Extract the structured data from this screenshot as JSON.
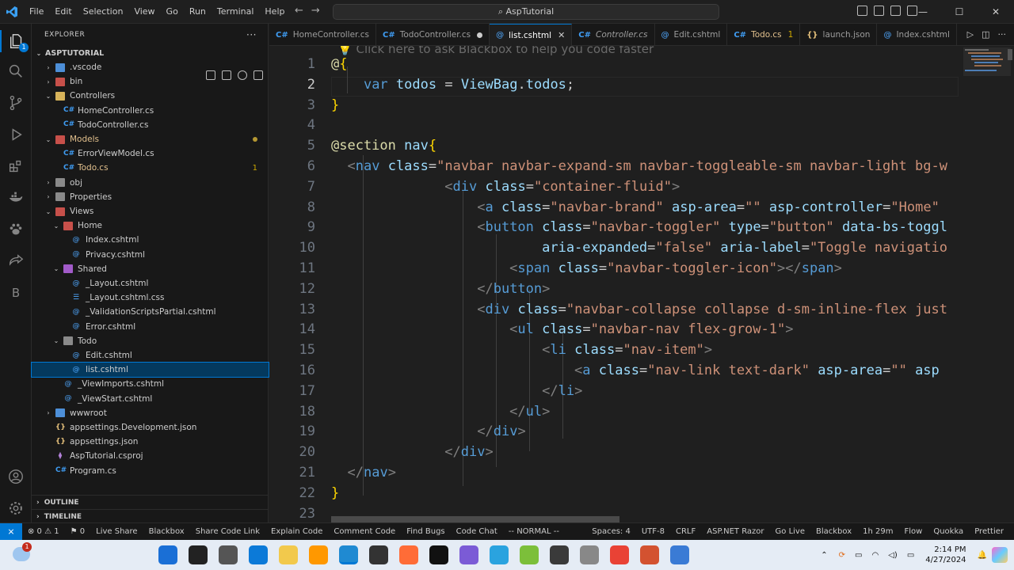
{
  "titlebar": {
    "menu": [
      "File",
      "Edit",
      "Selection",
      "View",
      "Go",
      "Run",
      "Terminal",
      "Help"
    ],
    "command_center": "AspTutorial",
    "window_controls": [
      "—",
      "☐",
      "✕"
    ]
  },
  "activity_bar": {
    "icons": [
      "explorer-icon",
      "search-icon",
      "source-control-icon",
      "run-debug-icon",
      "extensions-icon",
      "docker-icon",
      "paw-icon",
      "live-share-icon",
      "blackbox-icon",
      "account-icon",
      "settings-gear-icon"
    ],
    "explorer_badge": "1",
    "blackbox_letter": "B"
  },
  "sidebar": {
    "title": "EXPLORER",
    "root": "ASPTUTORIAL",
    "tree": [
      {
        "label": ".vscode",
        "kind": "folder",
        "color": "blue",
        "depth": 1,
        "open": false
      },
      {
        "label": "bin",
        "kind": "folder",
        "color": "red",
        "depth": 1,
        "open": false
      },
      {
        "label": "Controllers",
        "kind": "folder",
        "color": "yellow",
        "depth": 1,
        "open": true
      },
      {
        "label": "HomeController.cs",
        "kind": "cs",
        "depth": 2
      },
      {
        "label": "TodoController.cs",
        "kind": "cs",
        "depth": 2
      },
      {
        "label": "Models",
        "kind": "folder",
        "color": "red",
        "depth": 1,
        "open": true,
        "modified": true
      },
      {
        "label": "ErrorViewModel.cs",
        "kind": "cs",
        "depth": 2
      },
      {
        "label": "Todo.cs",
        "kind": "cs",
        "depth": 2,
        "problems": "1"
      },
      {
        "label": "obj",
        "kind": "folder",
        "color": "gray",
        "depth": 1,
        "open": false
      },
      {
        "label": "Properties",
        "kind": "folder",
        "color": "gray",
        "depth": 1,
        "open": false
      },
      {
        "label": "Views",
        "kind": "folder",
        "color": "red",
        "depth": 1,
        "open": true
      },
      {
        "label": "Home",
        "kind": "folder",
        "color": "red",
        "depth": 2,
        "open": true
      },
      {
        "label": "Index.cshtml",
        "kind": "at",
        "depth": 3
      },
      {
        "label": "Privacy.cshtml",
        "kind": "at",
        "depth": 3
      },
      {
        "label": "Shared",
        "kind": "folder",
        "color": "purple",
        "depth": 2,
        "open": true
      },
      {
        "label": "_Layout.cshtml",
        "kind": "at",
        "depth": 3
      },
      {
        "label": "_Layout.cshtml.css",
        "kind": "css",
        "depth": 3
      },
      {
        "label": "_ValidationScriptsPartial.cshtml",
        "kind": "at",
        "depth": 3
      },
      {
        "label": "Error.cshtml",
        "kind": "at",
        "depth": 3
      },
      {
        "label": "Todo",
        "kind": "folder",
        "color": "gray",
        "depth": 2,
        "open": true
      },
      {
        "label": "Edit.cshtml",
        "kind": "at",
        "depth": 3
      },
      {
        "label": "list.cshtml",
        "kind": "at",
        "depth": 3,
        "selected": true
      },
      {
        "label": "_ViewImports.cshtml",
        "kind": "at",
        "depth": 2
      },
      {
        "label": "_ViewStart.cshtml",
        "kind": "at",
        "depth": 2
      },
      {
        "label": "wwwroot",
        "kind": "folder",
        "color": "blue",
        "depth": 1,
        "open": false
      },
      {
        "label": "appsettings.Development.json",
        "kind": "json",
        "depth": 1
      },
      {
        "label": "appsettings.json",
        "kind": "json",
        "depth": 1
      },
      {
        "label": "AspTutorial.csproj",
        "kind": "proj",
        "depth": 1
      },
      {
        "label": "Program.cs",
        "kind": "cs",
        "depth": 1
      }
    ],
    "outline": "OUTLINE",
    "timeline": "TIMELINE"
  },
  "tabs": [
    {
      "label": "HomeController.cs",
      "icon": "C#"
    },
    {
      "label": "TodoController.cs",
      "icon": "C#",
      "dirty": true
    },
    {
      "label": "list.cshtml",
      "icon": "@",
      "active": true
    },
    {
      "label": "Controller.cs",
      "icon": "C#",
      "italic": true
    },
    {
      "label": "Edit.cshtml",
      "icon": "@"
    },
    {
      "label": "Todo.cs",
      "icon": "C#",
      "problems": "1"
    },
    {
      "label": "launch.json",
      "icon": "{}"
    },
    {
      "label": "Index.cshtml",
      "icon": "@"
    }
  ],
  "editor": {
    "hint": "Click here to ask Blackbox to help you code faster",
    "current_line": 2,
    "lines": [
      [
        [
          "razor",
          "@"
        ],
        [
          "brk",
          "{"
        ]
      ],
      [
        [
          "",
          "    "
        ],
        [
          "kw",
          "var"
        ],
        [
          "",
          " "
        ],
        [
          "var",
          "todos"
        ],
        [
          "",
          " = "
        ],
        [
          "var",
          "ViewBag"
        ],
        [
          "",
          "."
        ],
        [
          "var",
          "todos"
        ],
        [
          "",
          ";"
        ]
      ],
      [
        [
          "brk",
          "}"
        ]
      ],
      [],
      [
        [
          "razor",
          "@section"
        ],
        [
          "",
          " "
        ],
        [
          "var",
          "nav"
        ],
        [
          "brk",
          "{"
        ]
      ],
      [
        [
          "",
          "  "
        ],
        [
          "gray",
          "<"
        ],
        [
          "tag",
          "nav"
        ],
        [
          "",
          " "
        ],
        [
          "attr",
          "class"
        ],
        [
          "",
          "="
        ],
        [
          "str",
          "\"navbar navbar-expand-sm navbar-toggleable-sm navbar-light bg-w"
        ]
      ],
      [
        [
          "",
          "              "
        ],
        [
          "gray",
          "<"
        ],
        [
          "tag",
          "div"
        ],
        [
          "",
          " "
        ],
        [
          "attr",
          "class"
        ],
        [
          "",
          "="
        ],
        [
          "str",
          "\"container-fluid\""
        ],
        [
          "gray",
          ">"
        ]
      ],
      [
        [
          "",
          "                  "
        ],
        [
          "gray",
          "<"
        ],
        [
          "tag",
          "a"
        ],
        [
          "",
          " "
        ],
        [
          "attr",
          "class"
        ],
        [
          "",
          "="
        ],
        [
          "str",
          "\"navbar-brand\""
        ],
        [
          "",
          " "
        ],
        [
          "attr",
          "asp-area"
        ],
        [
          "",
          "="
        ],
        [
          "str",
          "\"\""
        ],
        [
          "",
          " "
        ],
        [
          "attr",
          "asp-controller"
        ],
        [
          "",
          "="
        ],
        [
          "str",
          "\"Home\""
        ]
      ],
      [
        [
          "",
          "                  "
        ],
        [
          "gray",
          "<"
        ],
        [
          "tag",
          "button"
        ],
        [
          "",
          " "
        ],
        [
          "attr",
          "class"
        ],
        [
          "",
          "="
        ],
        [
          "str",
          "\"navbar-toggler\""
        ],
        [
          "",
          " "
        ],
        [
          "attr",
          "type"
        ],
        [
          "",
          "="
        ],
        [
          "str",
          "\"button\""
        ],
        [
          "",
          " "
        ],
        [
          "attr",
          "data-bs-toggl"
        ]
      ],
      [
        [
          "",
          "                          "
        ],
        [
          "attr",
          "aria-expanded"
        ],
        [
          "",
          "="
        ],
        [
          "str",
          "\"false\""
        ],
        [
          "",
          " "
        ],
        [
          "attr",
          "aria-label"
        ],
        [
          "",
          "="
        ],
        [
          "str",
          "\"Toggle navigatio"
        ]
      ],
      [
        [
          "",
          "                      "
        ],
        [
          "gray",
          "<"
        ],
        [
          "tag",
          "span"
        ],
        [
          "",
          " "
        ],
        [
          "attr",
          "class"
        ],
        [
          "",
          "="
        ],
        [
          "str",
          "\"navbar-toggler-icon\""
        ],
        [
          "gray",
          "></"
        ],
        [
          "tag",
          "span"
        ],
        [
          "gray",
          ">"
        ]
      ],
      [
        [
          "",
          "                  "
        ],
        [
          "gray",
          "</"
        ],
        [
          "tag",
          "button"
        ],
        [
          "gray",
          ">"
        ]
      ],
      [
        [
          "",
          "                  "
        ],
        [
          "gray",
          "<"
        ],
        [
          "tag",
          "div"
        ],
        [
          "",
          " "
        ],
        [
          "attr",
          "class"
        ],
        [
          "",
          "="
        ],
        [
          "str",
          "\"navbar-collapse collapse d-sm-inline-flex just"
        ]
      ],
      [
        [
          "",
          "                      "
        ],
        [
          "gray",
          "<"
        ],
        [
          "tag",
          "ul"
        ],
        [
          "",
          " "
        ],
        [
          "attr",
          "class"
        ],
        [
          "",
          "="
        ],
        [
          "str",
          "\"navbar-nav flex-grow-1\""
        ],
        [
          "gray",
          ">"
        ]
      ],
      [
        [
          "",
          "                          "
        ],
        [
          "gray",
          "<"
        ],
        [
          "tag",
          "li"
        ],
        [
          "",
          " "
        ],
        [
          "attr",
          "class"
        ],
        [
          "",
          "="
        ],
        [
          "str",
          "\"nav-item\""
        ],
        [
          "gray",
          ">"
        ]
      ],
      [
        [
          "",
          "                              "
        ],
        [
          "gray",
          "<"
        ],
        [
          "tag",
          "a"
        ],
        [
          "",
          " "
        ],
        [
          "attr",
          "class"
        ],
        [
          "",
          "="
        ],
        [
          "str",
          "\"nav-link text-dark\""
        ],
        [
          "",
          " "
        ],
        [
          "attr",
          "asp-area"
        ],
        [
          "",
          "="
        ],
        [
          "str",
          "\"\""
        ],
        [
          "",
          " "
        ],
        [
          "attr",
          "asp"
        ]
      ],
      [
        [
          "",
          "                          "
        ],
        [
          "gray",
          "</"
        ],
        [
          "tag",
          "li"
        ],
        [
          "gray",
          ">"
        ]
      ],
      [
        [
          "",
          "                      "
        ],
        [
          "gray",
          "</"
        ],
        [
          "tag",
          "ul"
        ],
        [
          "gray",
          ">"
        ]
      ],
      [
        [
          "",
          "                  "
        ],
        [
          "gray",
          "</"
        ],
        [
          "tag",
          "div"
        ],
        [
          "gray",
          ">"
        ]
      ],
      [
        [
          "",
          "              "
        ],
        [
          "gray",
          "</"
        ],
        [
          "tag",
          "div"
        ],
        [
          "gray",
          ">"
        ]
      ],
      [
        [
          "",
          "  "
        ],
        [
          "gray",
          "</"
        ],
        [
          "tag",
          "nav"
        ],
        [
          "gray",
          ">"
        ]
      ],
      [
        [
          "brk",
          "}"
        ]
      ],
      []
    ]
  },
  "statusbar": {
    "remote": "⨯",
    "items": [
      "⊗ 0 ⚠ 1",
      "⚑ 0",
      "Live Share",
      "Blackbox",
      "Share Code Link",
      "Explain Code",
      "Comment Code",
      "Find Bugs",
      "Code Chat",
      "-- NORMAL --"
    ],
    "right": [
      "Spaces: 4",
      "UTF-8",
      "CRLF",
      "ASP.NET Razor",
      "Go Live",
      "Blackbox",
      "1h 29m",
      "Flow",
      "Quokka",
      "Prettier"
    ]
  },
  "taskbar": {
    "notification_badge": "1",
    "time": "2:14 PM",
    "date": "4/27/2024",
    "pinned": [
      "weather-icon",
      "start-icon",
      "search-icon",
      "task-view-icon",
      "edge-icon",
      "file-explorer-icon",
      "sublime-icon",
      "vscode-icon",
      "terminal-icon",
      "postman-icon",
      "notion-icon",
      "visual-studio-icon",
      "telegram-icon",
      "notepadpp-icon",
      "calendar-icon",
      "storage-icon",
      "chrome-icon",
      "powerpoint-icon",
      "snipping-icon"
    ],
    "colors": {
      "accent": "#0078d4",
      "taskbar": "#e5ecf5"
    }
  }
}
